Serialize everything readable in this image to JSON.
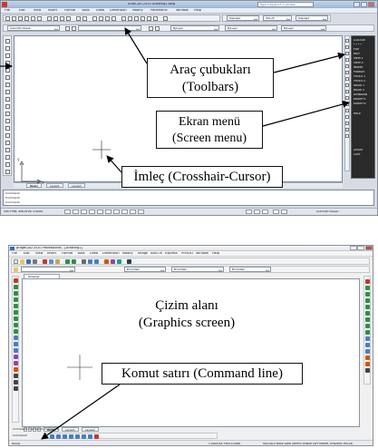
{
  "top_window": {
    "title": "AutoCAD 2010    Drawing1.dwg",
    "help_search_placeholder": "Type a keyword or phrase",
    "menus": [
      "File",
      "Edit",
      "View",
      "Insert",
      "Format",
      "Tools",
      "Draw",
      "Dimension",
      "Modify",
      "Parametric",
      "Window",
      "Help"
    ],
    "workspace_combo": "AutoCAD Classic",
    "text_style": "Standard",
    "dim_style": "ISO-25",
    "table_style": "Standard",
    "layer_combo": "ByLayer",
    "linetype_combo": "ByLayer",
    "lineweight_combo": "ByLayer",
    "screen_menu": [
      "AutoCAD",
      "* * * *",
      "FILE",
      "EDIT",
      "VIEW 1",
      "VIEW 2",
      "INSERT",
      "FORMAT",
      "TOOLS 1",
      "TOOLS 2",
      "DRAW 1",
      "DRAW 2",
      "DIMNSION",
      "MODIFY1",
      "MODIFY2",
      "",
      "HELP",
      "",
      "",
      "",
      "",
      "",
      "",
      "",
      "ASSIST",
      "LAST"
    ],
    "tabs": [
      "Model",
      "Layout1",
      "Layout2"
    ],
    "command_lines": [
      "Command:",
      "Command:",
      "Command:"
    ],
    "status_coords": "396.7788, 408.0729, 0.0000",
    "status_workspace": "AutoCAD Classic"
  },
  "bottom_window": {
    "title": "progeCAD 2010 Professional - [Drawing1]",
    "menus": [
      "File",
      "Edit",
      "View",
      "Insert",
      "Format",
      "Tools",
      "Draw",
      "Dimension",
      "Modify",
      "Image",
      "Add-On",
      "Express",
      "Print3D",
      "Window",
      "Help"
    ],
    "layer_combo": "BYLAYER",
    "linetype_combo": "BYLAYER",
    "lineweight_combo": "BYLAYER",
    "doc_tab": "Drawing1",
    "tabs": [
      "Model",
      "Layout1",
      "Layout2"
    ],
    "command_lines": [
      "Command: Command: Command:",
      "Command:"
    ],
    "status_left": "Ready",
    "status_coords": "1.0000,64.7300,0.0000",
    "status_right": "Standard  SNAP  GRID  ORTHO  OSNAP  LWT  MODEL  DYNAMIC  POLAR"
  },
  "callouts": {
    "toolbars": [
      "Araç çubukları",
      "(Toolbars)"
    ],
    "screen_menu": [
      "Ekran menü",
      "(Screen menu)"
    ],
    "cursor": "İmleç (Crosshair-Cursor)",
    "graphics": [
      "Çizim alanı",
      "(Graphics screen)"
    ],
    "command_line": "Komut satırı (Command line)"
  },
  "colors": {
    "accent_autocad_title": "#9eb6d6",
    "screen_menu_bg": "#2a2a2a",
    "arrow": "#000000"
  }
}
